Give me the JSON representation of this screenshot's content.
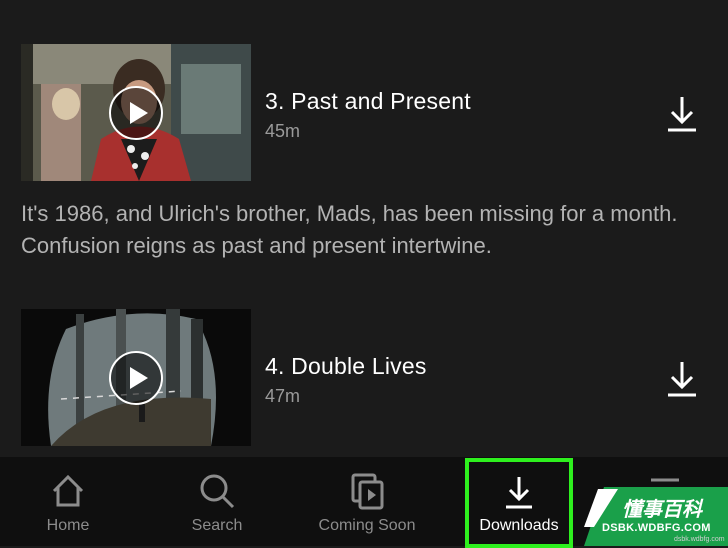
{
  "episodes": [
    {
      "title": "3. Past and Present",
      "duration": "45m",
      "synopsis": "It's 1986, and Ulrich's brother, Mads, has been missing for a month. Confusion reigns as past and present intertwine."
    },
    {
      "title": "4. Double Lives",
      "duration": "47m"
    }
  ],
  "tabs": [
    {
      "label": "Home",
      "icon": "home-icon"
    },
    {
      "label": "Search",
      "icon": "search-icon"
    },
    {
      "label": "Coming Soon",
      "icon": "coming-soon-icon"
    },
    {
      "label": "Downloads",
      "icon": "download-icon",
      "active": true
    },
    {
      "label": "",
      "icon": "menu-icon"
    }
  ],
  "colors": {
    "background": "#1b1b1b",
    "tabbar": "#0f0f0f",
    "highlight": "#2ef01e",
    "watermark": "#1aa04a"
  },
  "watermark": {
    "title": "懂事百科",
    "url": "DSBK.WDBFG.COM",
    "small": "dsbk.wdbfg.com"
  }
}
